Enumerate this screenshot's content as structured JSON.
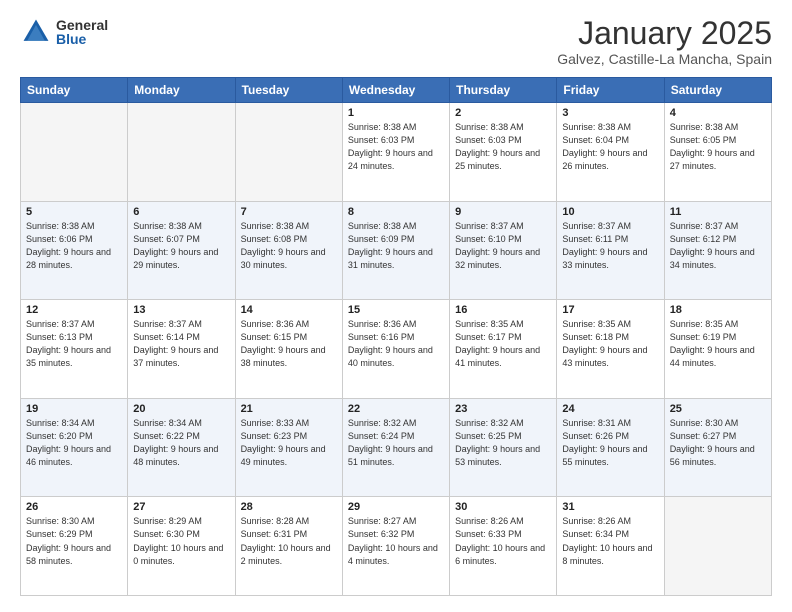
{
  "logo": {
    "general": "General",
    "blue": "Blue"
  },
  "header": {
    "month": "January 2025",
    "location": "Galvez, Castille-La Mancha, Spain"
  },
  "weekdays": [
    "Sunday",
    "Monday",
    "Tuesday",
    "Wednesday",
    "Thursday",
    "Friday",
    "Saturday"
  ],
  "weeks": [
    [
      {
        "day": "",
        "sunrise": "",
        "sunset": "",
        "daylight": "",
        "empty": true
      },
      {
        "day": "",
        "sunrise": "",
        "sunset": "",
        "daylight": "",
        "empty": true
      },
      {
        "day": "",
        "sunrise": "",
        "sunset": "",
        "daylight": "",
        "empty": true
      },
      {
        "day": "1",
        "sunrise": "Sunrise: 8:38 AM",
        "sunset": "Sunset: 6:03 PM",
        "daylight": "Daylight: 9 hours and 24 minutes."
      },
      {
        "day": "2",
        "sunrise": "Sunrise: 8:38 AM",
        "sunset": "Sunset: 6:03 PM",
        "daylight": "Daylight: 9 hours and 25 minutes."
      },
      {
        "day": "3",
        "sunrise": "Sunrise: 8:38 AM",
        "sunset": "Sunset: 6:04 PM",
        "daylight": "Daylight: 9 hours and 26 minutes."
      },
      {
        "day": "4",
        "sunrise": "Sunrise: 8:38 AM",
        "sunset": "Sunset: 6:05 PM",
        "daylight": "Daylight: 9 hours and 27 minutes."
      }
    ],
    [
      {
        "day": "5",
        "sunrise": "Sunrise: 8:38 AM",
        "sunset": "Sunset: 6:06 PM",
        "daylight": "Daylight: 9 hours and 28 minutes."
      },
      {
        "day": "6",
        "sunrise": "Sunrise: 8:38 AM",
        "sunset": "Sunset: 6:07 PM",
        "daylight": "Daylight: 9 hours and 29 minutes."
      },
      {
        "day": "7",
        "sunrise": "Sunrise: 8:38 AM",
        "sunset": "Sunset: 6:08 PM",
        "daylight": "Daylight: 9 hours and 30 minutes."
      },
      {
        "day": "8",
        "sunrise": "Sunrise: 8:38 AM",
        "sunset": "Sunset: 6:09 PM",
        "daylight": "Daylight: 9 hours and 31 minutes."
      },
      {
        "day": "9",
        "sunrise": "Sunrise: 8:37 AM",
        "sunset": "Sunset: 6:10 PM",
        "daylight": "Daylight: 9 hours and 32 minutes."
      },
      {
        "day": "10",
        "sunrise": "Sunrise: 8:37 AM",
        "sunset": "Sunset: 6:11 PM",
        "daylight": "Daylight: 9 hours and 33 minutes."
      },
      {
        "day": "11",
        "sunrise": "Sunrise: 8:37 AM",
        "sunset": "Sunset: 6:12 PM",
        "daylight": "Daylight: 9 hours and 34 minutes."
      }
    ],
    [
      {
        "day": "12",
        "sunrise": "Sunrise: 8:37 AM",
        "sunset": "Sunset: 6:13 PM",
        "daylight": "Daylight: 9 hours and 35 minutes."
      },
      {
        "day": "13",
        "sunrise": "Sunrise: 8:37 AM",
        "sunset": "Sunset: 6:14 PM",
        "daylight": "Daylight: 9 hours and 37 minutes."
      },
      {
        "day": "14",
        "sunrise": "Sunrise: 8:36 AM",
        "sunset": "Sunset: 6:15 PM",
        "daylight": "Daylight: 9 hours and 38 minutes."
      },
      {
        "day": "15",
        "sunrise": "Sunrise: 8:36 AM",
        "sunset": "Sunset: 6:16 PM",
        "daylight": "Daylight: 9 hours and 40 minutes."
      },
      {
        "day": "16",
        "sunrise": "Sunrise: 8:35 AM",
        "sunset": "Sunset: 6:17 PM",
        "daylight": "Daylight: 9 hours and 41 minutes."
      },
      {
        "day": "17",
        "sunrise": "Sunrise: 8:35 AM",
        "sunset": "Sunset: 6:18 PM",
        "daylight": "Daylight: 9 hours and 43 minutes."
      },
      {
        "day": "18",
        "sunrise": "Sunrise: 8:35 AM",
        "sunset": "Sunset: 6:19 PM",
        "daylight": "Daylight: 9 hours and 44 minutes."
      }
    ],
    [
      {
        "day": "19",
        "sunrise": "Sunrise: 8:34 AM",
        "sunset": "Sunset: 6:20 PM",
        "daylight": "Daylight: 9 hours and 46 minutes."
      },
      {
        "day": "20",
        "sunrise": "Sunrise: 8:34 AM",
        "sunset": "Sunset: 6:22 PM",
        "daylight": "Daylight: 9 hours and 48 minutes."
      },
      {
        "day": "21",
        "sunrise": "Sunrise: 8:33 AM",
        "sunset": "Sunset: 6:23 PM",
        "daylight": "Daylight: 9 hours and 49 minutes."
      },
      {
        "day": "22",
        "sunrise": "Sunrise: 8:32 AM",
        "sunset": "Sunset: 6:24 PM",
        "daylight": "Daylight: 9 hours and 51 minutes."
      },
      {
        "day": "23",
        "sunrise": "Sunrise: 8:32 AM",
        "sunset": "Sunset: 6:25 PM",
        "daylight": "Daylight: 9 hours and 53 minutes."
      },
      {
        "day": "24",
        "sunrise": "Sunrise: 8:31 AM",
        "sunset": "Sunset: 6:26 PM",
        "daylight": "Daylight: 9 hours and 55 minutes."
      },
      {
        "day": "25",
        "sunrise": "Sunrise: 8:30 AM",
        "sunset": "Sunset: 6:27 PM",
        "daylight": "Daylight: 9 hours and 56 minutes."
      }
    ],
    [
      {
        "day": "26",
        "sunrise": "Sunrise: 8:30 AM",
        "sunset": "Sunset: 6:29 PM",
        "daylight": "Daylight: 9 hours and 58 minutes."
      },
      {
        "day": "27",
        "sunrise": "Sunrise: 8:29 AM",
        "sunset": "Sunset: 6:30 PM",
        "daylight": "Daylight: 10 hours and 0 minutes."
      },
      {
        "day": "28",
        "sunrise": "Sunrise: 8:28 AM",
        "sunset": "Sunset: 6:31 PM",
        "daylight": "Daylight: 10 hours and 2 minutes."
      },
      {
        "day": "29",
        "sunrise": "Sunrise: 8:27 AM",
        "sunset": "Sunset: 6:32 PM",
        "daylight": "Daylight: 10 hours and 4 minutes."
      },
      {
        "day": "30",
        "sunrise": "Sunrise: 8:26 AM",
        "sunset": "Sunset: 6:33 PM",
        "daylight": "Daylight: 10 hours and 6 minutes."
      },
      {
        "day": "31",
        "sunrise": "Sunrise: 8:26 AM",
        "sunset": "Sunset: 6:34 PM",
        "daylight": "Daylight: 10 hours and 8 minutes."
      },
      {
        "day": "",
        "sunrise": "",
        "sunset": "",
        "daylight": "",
        "empty": true
      }
    ]
  ]
}
